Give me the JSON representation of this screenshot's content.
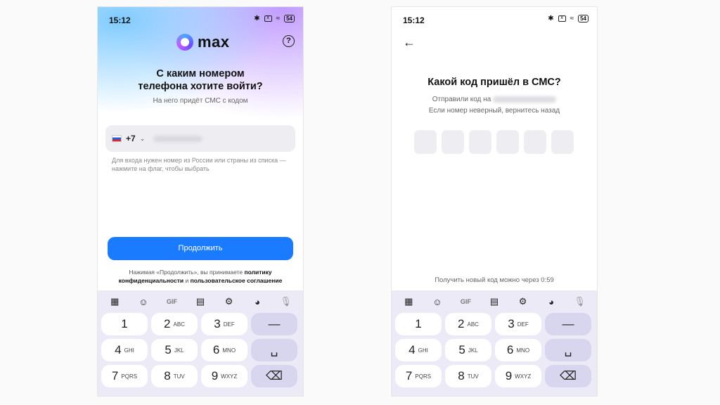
{
  "status": {
    "time": "15:12",
    "wifi": "≈",
    "battery": "54",
    "x_icon": "x"
  },
  "screen1": {
    "brand": "max",
    "help": "?",
    "title_line1": "С каким номером",
    "title_line2": "телефона хотите войти?",
    "subtitle": "На него придёт СМС с кодом",
    "country_code": "+7",
    "chevron": "⌄",
    "hint": "Для входа нужен номер из России или страны из списка — нажмите на флаг, чтобы выбрать",
    "continue_label": "Продолжить",
    "terms_prefix": "Нажимая «Продолжить», вы принимаете",
    "terms_policy_1": "политику",
    "terms_policy_2": "конфиденциальности",
    "terms_and": "и",
    "terms_agreement": "пользовательское соглашение"
  },
  "screen2": {
    "back": "←",
    "title": "Какой код пришёл в СМС?",
    "sent_to": "Отправили код на",
    "wrong_number": "Если номер неверный, вернитесь назад",
    "resend": "Получить новый код можно через 0:59"
  },
  "keyboard": {
    "tools": {
      "grid": "▦",
      "sticker": "☺",
      "gif": "GIF",
      "clipboard": "▤",
      "settings": "⚙",
      "theme": "◕",
      "mic": "🎙"
    },
    "keys": [
      [
        {
          "n": "1",
          "l": ""
        },
        {
          "n": "2",
          "l": "ABC"
        },
        {
          "n": "3",
          "l": "DEF"
        },
        {
          "n": "—",
          "l": "",
          "fn": true
        }
      ],
      [
        {
          "n": "4",
          "l": "GHI"
        },
        {
          "n": "5",
          "l": "JKL"
        },
        {
          "n": "6",
          "l": "MNO"
        },
        {
          "n": "␣",
          "l": "",
          "fn": true
        }
      ],
      [
        {
          "n": "7",
          "l": "PQRS"
        },
        {
          "n": "8",
          "l": "TUV"
        },
        {
          "n": "9",
          "l": "WXYZ"
        },
        {
          "n": "⌫",
          "l": "",
          "fn": true
        }
      ]
    ]
  },
  "colors": {
    "accent": "#1a7bff",
    "arrow": "#f04a23",
    "keyboard_bg": "#eceaf7"
  }
}
